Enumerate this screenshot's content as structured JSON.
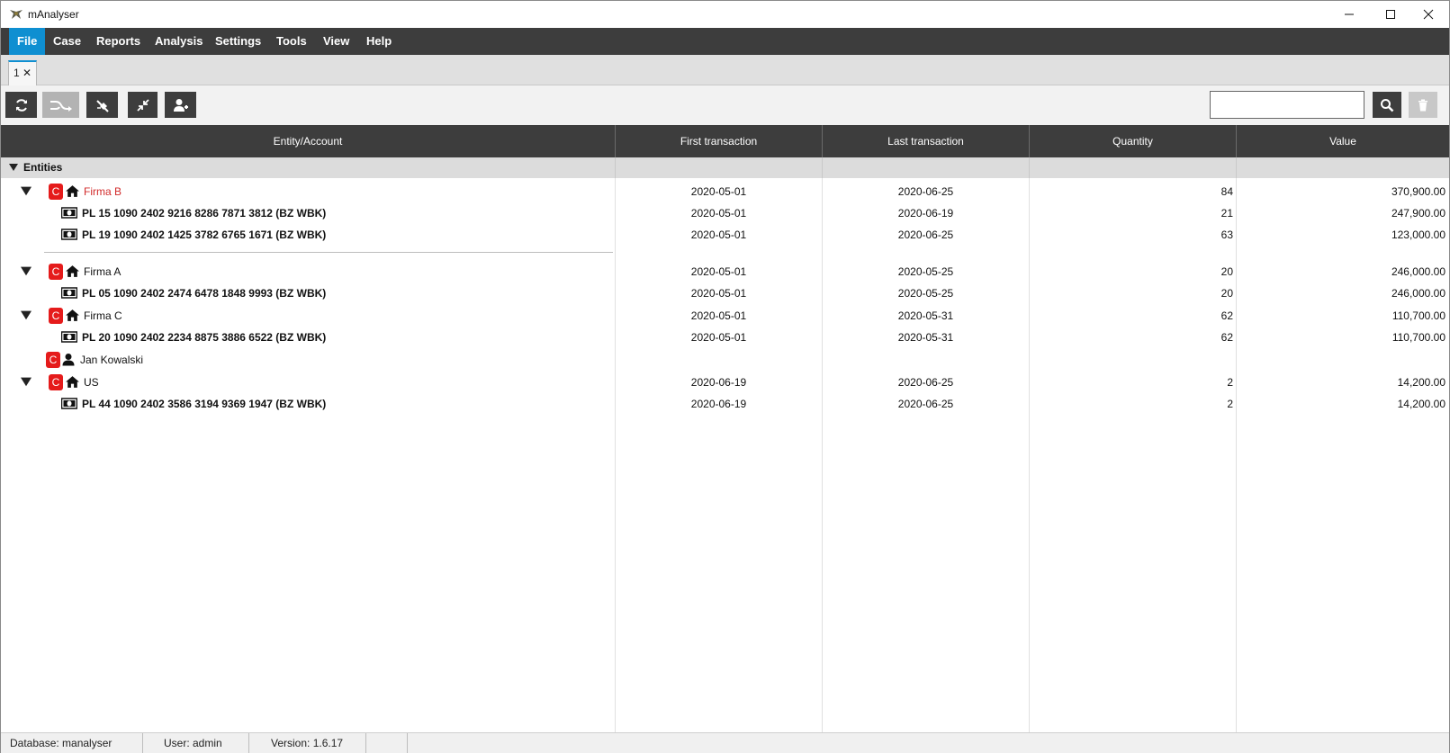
{
  "window": {
    "title": "mAnalyser"
  },
  "menu": [
    {
      "label": "File",
      "active": true
    },
    {
      "label": "Case"
    },
    {
      "label": "Reports"
    },
    {
      "label": "Analysis"
    },
    {
      "label": "Settings"
    },
    {
      "label": "Tools"
    },
    {
      "label": "View"
    },
    {
      "label": "Help"
    }
  ],
  "tabs": [
    {
      "label": "1 ✕"
    }
  ],
  "toolbar": {
    "search_placeholder": "",
    "buttons": [
      "refresh-icon",
      "flow-icon",
      "tag-remove-icon",
      "collapse-icon",
      "add-user-icon"
    ]
  },
  "grid": {
    "columns": [
      "Entity/Account",
      "First transaction",
      "Last transaction",
      "Quantity",
      "Value"
    ],
    "group_label": "Entities",
    "badge": "C",
    "rows": [
      {
        "type": "entity",
        "icon": "home-icon",
        "name": "Firma B",
        "highlight": true,
        "first": "2020-05-01",
        "last": "2020-06-25",
        "qty": "84",
        "value": "370,900.00"
      },
      {
        "type": "account",
        "name": "PL 15 1090 2402 9216 8286 7871 3812 (BZ WBK)",
        "first": "2020-05-01",
        "last": "2020-06-19",
        "qty": "21",
        "value": "247,900.00"
      },
      {
        "type": "account",
        "name": "PL 19 1090 2402 1425 3782 6765 1671 (BZ WBK)",
        "first": "2020-05-01",
        "last": "2020-06-25",
        "qty": "63",
        "value": "123,000.00"
      },
      {
        "type": "entity",
        "icon": "home-icon",
        "name": "Firma A",
        "first": "2020-05-01",
        "last": "2020-05-25",
        "qty": "20",
        "value": "246,000.00"
      },
      {
        "type": "account",
        "name": "PL 05 1090 2402 2474 6478 1848 9993 (BZ WBK)",
        "first": "2020-05-01",
        "last": "2020-05-25",
        "qty": "20",
        "value": "246,000.00"
      },
      {
        "type": "entity",
        "icon": "home-icon",
        "name": "Firma C",
        "first": "2020-05-01",
        "last": "2020-05-31",
        "qty": "62",
        "value": "110,700.00"
      },
      {
        "type": "account",
        "name": "PL 20 1090 2402 2234 8875 3886 6522 (BZ WBK)",
        "first": "2020-05-01",
        "last": "2020-05-31",
        "qty": "62",
        "value": "110,700.00"
      },
      {
        "type": "person",
        "icon": "person-icon",
        "name": "Jan Kowalski",
        "first": "",
        "last": "",
        "qty": "",
        "value": ""
      },
      {
        "type": "entity",
        "icon": "home-icon",
        "name": "US",
        "first": "2020-06-19",
        "last": "2020-06-25",
        "qty": "2",
        "value": "14,200.00"
      },
      {
        "type": "account",
        "name": "PL 44 1090 2402 3586 3194 9369 1947 (BZ WBK)",
        "first": "2020-06-19",
        "last": "2020-06-25",
        "qty": "2",
        "value": "14,200.00"
      }
    ]
  },
  "status": {
    "database": "Database: manalyser",
    "user": "User: admin",
    "version": "Version: 1.6.17"
  },
  "colors": {
    "menu_bg": "#3d3d3d",
    "menu_active": "#0f8fd1",
    "badge_red": "#e51b1b",
    "highlight_text": "#d22b2b"
  }
}
